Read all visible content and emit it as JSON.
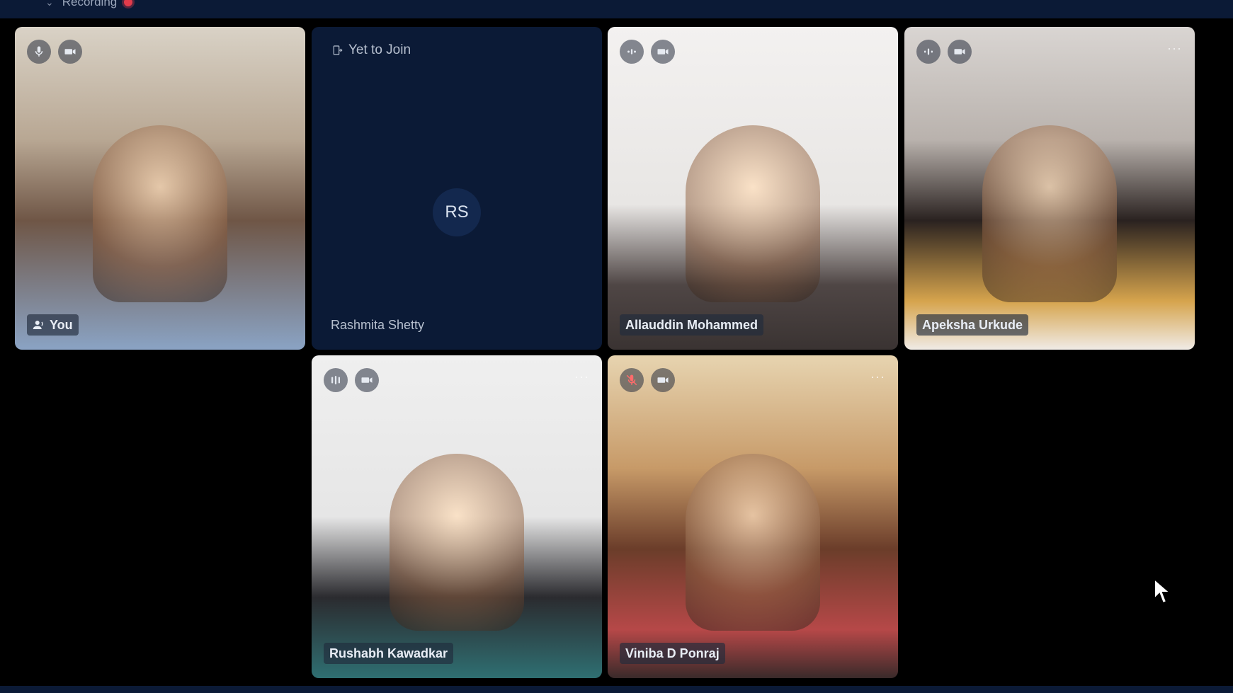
{
  "header": {
    "recording_label": "Recording",
    "recording_color": "#e23b4b"
  },
  "participants": [
    {
      "name": "You",
      "status": "speaking",
      "mic": "on",
      "camera": "on"
    },
    {
      "name": "Rashmita Shetty",
      "status": "Yet to Join",
      "initials": "RS"
    },
    {
      "name": "Allauddin Mohammed",
      "mic": "active",
      "camera": "on"
    },
    {
      "name": "Apeksha Urkude",
      "mic": "active",
      "camera": "on"
    },
    {
      "name": "Rushabh Kawadkar",
      "mic": "active",
      "camera": "on"
    },
    {
      "name": "Viniba D Ponraj",
      "mic": "muted",
      "camera": "on"
    }
  ],
  "more_label": "···",
  "colors": {
    "background": "#000000",
    "panel": "#0b1a36",
    "avatar": "#13284e",
    "label_bg": "#212b3c",
    "muted_icon": "#ff6b6b"
  }
}
